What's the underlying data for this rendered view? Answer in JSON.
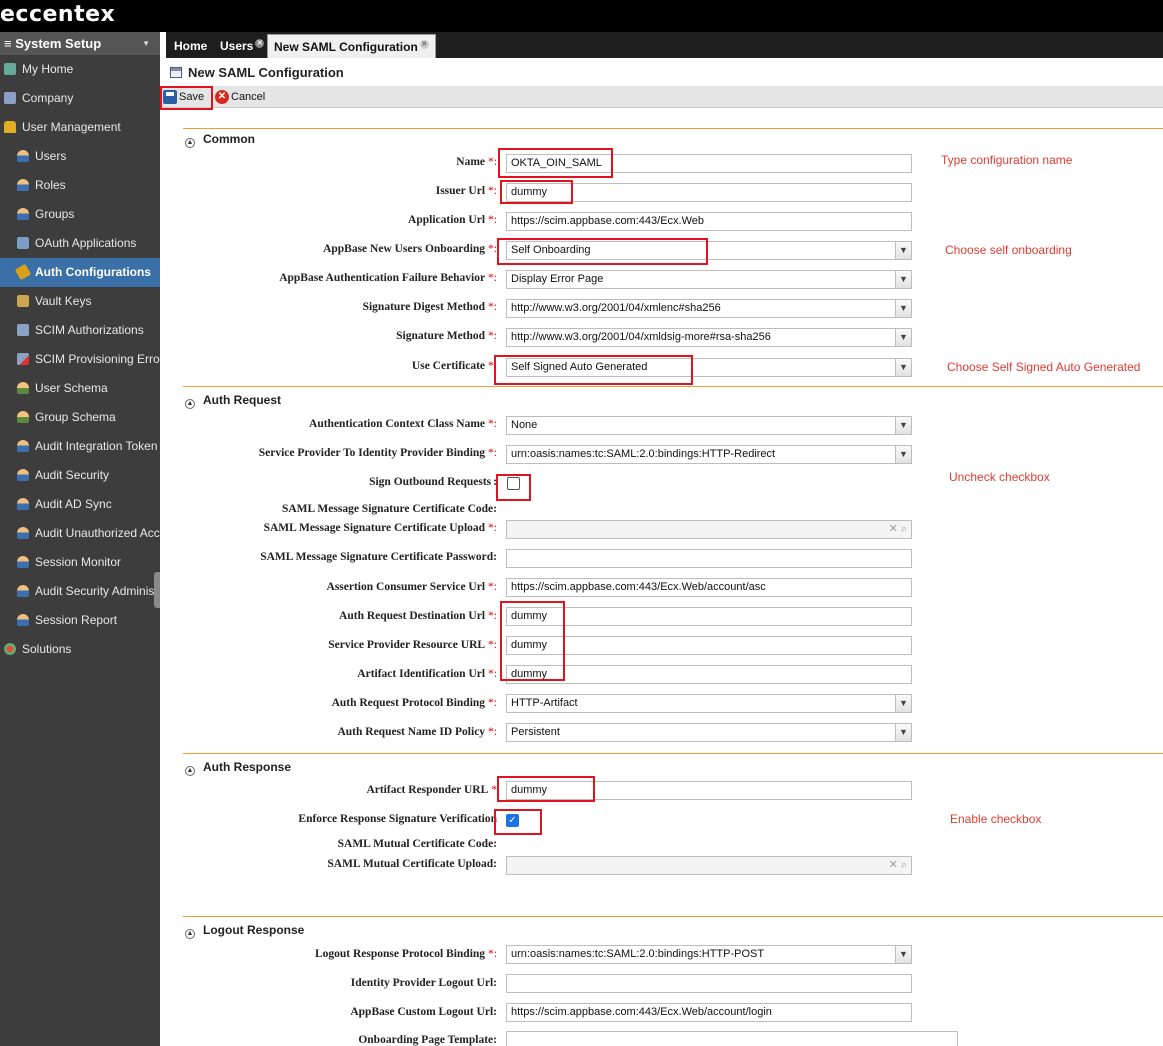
{
  "brand": "eccentex",
  "sidebar": {
    "header": "≡ System Setup",
    "items": [
      {
        "label": "My Home",
        "icon": "home-icon"
      },
      {
        "label": "Company",
        "icon": "company-icon"
      },
      {
        "label": "User Management",
        "icon": "lock-icon"
      },
      {
        "label": "Users",
        "icon": "user-icon"
      },
      {
        "label": "Roles",
        "icon": "user-icon"
      },
      {
        "label": "Groups",
        "icon": "group-icon"
      },
      {
        "label": "OAuth Applications",
        "icon": "oauth-icon"
      },
      {
        "label": "Auth Configurations",
        "icon": "key-icon"
      },
      {
        "label": "Vault Keys",
        "icon": "vault-icon"
      },
      {
        "label": "SCIM Authorizations",
        "icon": "scim-icon"
      },
      {
        "label": "SCIM Provisioning Errors",
        "icon": "scim-error-icon"
      },
      {
        "label": "User Schema",
        "icon": "schema-icon"
      },
      {
        "label": "Group Schema",
        "icon": "schema-icon"
      },
      {
        "label": "Audit Integration Token",
        "icon": "user-icon"
      },
      {
        "label": "Audit Security",
        "icon": "user-icon"
      },
      {
        "label": "Audit AD Sync",
        "icon": "user-icon"
      },
      {
        "label": "Audit Unauthorized Acces",
        "icon": "user-icon"
      },
      {
        "label": "Session Monitor",
        "icon": "user-icon"
      },
      {
        "label": "Audit Security Administrat",
        "icon": "user-icon"
      },
      {
        "label": "Session Report",
        "icon": "user-icon"
      },
      {
        "label": "Solutions",
        "icon": "solutions-icon"
      }
    ]
  },
  "tabs": [
    {
      "label": "Home"
    },
    {
      "label": "Users"
    },
    {
      "label": "New SAML Configuration"
    }
  ],
  "page": {
    "title": "New SAML Configuration",
    "save": "Save",
    "cancel": "Cancel"
  },
  "sections": {
    "common": "Common",
    "auth_request": "Auth Request",
    "auth_response": "Auth Response",
    "logout_response": "Logout Response"
  },
  "fields": {
    "name": {
      "label": "Name",
      "value": "OKTA_OIN_SAML"
    },
    "issuer_url": {
      "label": "Issuer Url",
      "value": "dummy"
    },
    "application_url": {
      "label": "Application Url",
      "value": "https://scim.appbase.com:443/Ecx.Web"
    },
    "new_users_onboarding": {
      "label": "AppBase New Users Onboarding",
      "value": "Self Onboarding"
    },
    "auth_failure_behavior": {
      "label": "AppBase Authentication Failure Behavior",
      "value": "Display Error Page"
    },
    "signature_digest_method": {
      "label": "Signature Digest Method",
      "value": "http://www.w3.org/2001/04/xmlenc#sha256"
    },
    "signature_method": {
      "label": "Signature Method",
      "value": "http://www.w3.org/2001/04/xmldsig-more#rsa-sha256"
    },
    "use_certificate": {
      "label": "Use Certificate",
      "value": "Self Signed Auto Generated"
    },
    "auth_context_class": {
      "label": "Authentication Context Class Name",
      "value": "None"
    },
    "sp_to_idp_binding": {
      "label": "Service Provider To Identity Provider Binding",
      "value": "urn:oasis:names:tc:SAML:2.0:bindings:HTTP-Redirect"
    },
    "sign_outbound_requests": {
      "label": "Sign Outbound Requests",
      "checked": false
    },
    "saml_msg_cert_code": {
      "label": "SAML Message Signature Certificate Code:"
    },
    "saml_msg_cert_upload": {
      "label": "SAML Message Signature Certificate Upload",
      "value": ""
    },
    "saml_msg_cert_password": {
      "label": "SAML Message Signature Certificate Password:",
      "value": ""
    },
    "acs_url": {
      "label": "Assertion Consumer Service Url",
      "value": "https://scim.appbase.com:443/Ecx.Web/account/asc"
    },
    "auth_req_dest_url": {
      "label": "Auth Request Destination Url",
      "value": "dummy"
    },
    "sp_resource_url": {
      "label": "Service Provider Resource URL",
      "value": "dummy"
    },
    "artifact_id_url": {
      "label": "Artifact Identification Url",
      "value": "dummy"
    },
    "auth_req_protocol_binding": {
      "label": "Auth Request Protocol Binding",
      "value": "HTTP-Artifact"
    },
    "auth_req_name_id_policy": {
      "label": "Auth Request Name ID Policy",
      "value": "Persistent"
    },
    "artifact_responder_url": {
      "label": "Artifact Responder URL",
      "value": "dummy"
    },
    "enforce_response_sig": {
      "label": "Enforce Response Signature Verification",
      "checked": true
    },
    "saml_mutual_cert_code": {
      "label": "SAML Mutual Certificate Code:"
    },
    "saml_mutual_cert_upload": {
      "label": "SAML Mutual Certificate Upload:",
      "value": ""
    },
    "logout_protocol_binding": {
      "label": "Logout Response Protocol Binding",
      "value": "urn:oasis:names:tc:SAML:2.0:bindings:HTTP-POST"
    },
    "idp_logout_url": {
      "label": "Identity Provider Logout Url:",
      "value": ""
    },
    "custom_logout_url": {
      "label": "AppBase Custom Logout Url:",
      "value": "https://scim.appbase.com:443/Ecx.Web/account/login"
    },
    "onboarding_template": {
      "label": "Onboarding Page Template:",
      "value": ""
    }
  },
  "marks": {
    "required": "*",
    "colon": ":",
    "required_colon": "*:"
  },
  "annotations": {
    "type_name": "Type configuration name",
    "choose_self_onboarding": "Choose self onboarding",
    "choose_self_signed": "Choose Self Signed Auto Generated",
    "uncheck_checkbox": "Uncheck checkbox",
    "enable_checkbox": "Enable checkbox"
  },
  "colors": {
    "annotation": "#e03c31",
    "highlight_box": "#e0141e",
    "section_rule": "#f0a030",
    "sidebar_active": "#3a6fa8",
    "required_marker": "#dd0000"
  }
}
